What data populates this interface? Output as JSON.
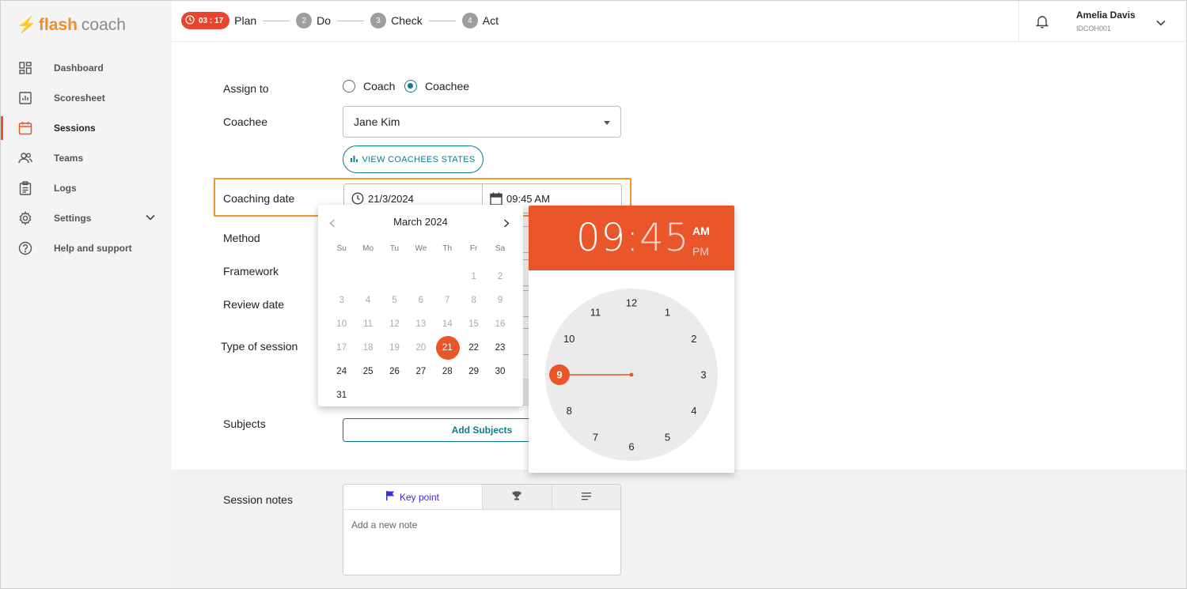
{
  "app": {
    "logo_brand": "flash",
    "logo_product": "coach"
  },
  "sidebar": {
    "items": [
      {
        "label": "Dashboard",
        "icon": "dashboard-icon"
      },
      {
        "label": "Scoresheet",
        "icon": "chart-icon"
      },
      {
        "label": "Sessions",
        "icon": "calendar-icon",
        "active": true
      },
      {
        "label": "Teams",
        "icon": "people-icon"
      },
      {
        "label": "Logs",
        "icon": "clipboard-icon"
      },
      {
        "label": "Settings",
        "icon": "gear-icon",
        "expandable": true
      },
      {
        "label": "Help and support",
        "icon": "help-icon"
      }
    ]
  },
  "topbar": {
    "timer": "03 : 17",
    "steps": [
      {
        "num": "",
        "label": "Plan"
      },
      {
        "num": "2",
        "label": "Do"
      },
      {
        "num": "3",
        "label": "Check"
      },
      {
        "num": "4",
        "label": "Act"
      }
    ],
    "user": {
      "name": "Amelia Davis",
      "id": "IDCOH001"
    }
  },
  "form": {
    "assign_to_label": "Assign to",
    "assign_options": [
      "Coach",
      "Coachee"
    ],
    "assign_selected": "Coachee",
    "coachee_label": "Coachee",
    "coachee_value": "Jane Kim",
    "view_states_button": "VIEW COACHEES STATES",
    "coaching_date_label": "Coaching date",
    "date_value": "21/3/2024",
    "time_value": "09:45 AM",
    "method_label": "Method",
    "framework_label": "Framework",
    "review_date_label": "Review date",
    "type_label": "Type of session",
    "subjects_label": "Subjects",
    "add_subjects_button": "Add Subjects",
    "session_notes_label": "Session notes",
    "notes_tab_keypoint": "Key point",
    "notes_placeholder": "Add a new note"
  },
  "calendar": {
    "month": "March 2024",
    "weekdays": [
      "Su",
      "Mo",
      "Tu",
      "We",
      "Th",
      "Fr",
      "Sa"
    ],
    "weeks": [
      [
        "",
        "",
        "",
        "",
        "",
        "1",
        "2"
      ],
      [
        "3",
        "4",
        "5",
        "6",
        "7",
        "8",
        "9"
      ],
      [
        "10",
        "11",
        "12",
        "13",
        "14",
        "15",
        "16"
      ],
      [
        "17",
        "18",
        "19",
        "20",
        "21",
        "22",
        "23"
      ],
      [
        "24",
        "25",
        "26",
        "27",
        "28",
        "29",
        "30"
      ],
      [
        "31",
        "",
        "",
        "",
        "",
        "",
        ""
      ]
    ],
    "selected_day": "21",
    "first_enabled_day": 21
  },
  "clock": {
    "hour": "09",
    "colon": ":",
    "minute": "45",
    "am": "AM",
    "pm": "PM",
    "period": "AM",
    "selected_hour": 9,
    "numbers": [
      "12",
      "1",
      "2",
      "3",
      "4",
      "5",
      "6",
      "7",
      "8",
      "9",
      "10",
      "11"
    ]
  },
  "colors": {
    "accent": "#e8562a",
    "teal": "#0f7c8c",
    "highlight": "#f4962a",
    "timer": "#e8452c"
  }
}
